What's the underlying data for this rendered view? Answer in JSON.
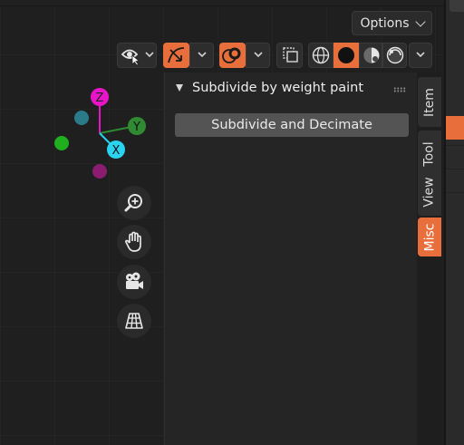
{
  "header": {
    "options_label": "Options"
  },
  "gizmo": {
    "z_label": "Z",
    "y_label": "Y",
    "x_label": "X",
    "colors": {
      "z": "#e815c8",
      "y": "#2f8a31",
      "x": "#2ad3f0",
      "neg_z": "#8c1c70",
      "neg_y": "#1faf1f",
      "neg_x": "#2a7a8a"
    }
  },
  "panel": {
    "title": "Subdivide by weight paint",
    "button_label": "Subdivide and Decimate"
  },
  "tabs": [
    {
      "label": "Item",
      "active": false
    },
    {
      "label": "Tool",
      "active": false
    },
    {
      "label": "View",
      "active": false
    },
    {
      "label": "Misc",
      "active": true
    }
  ],
  "theme": {
    "accent": "#e86f3c",
    "panel_bg": "#252525",
    "viewport_bg": "#1f1f1f"
  }
}
